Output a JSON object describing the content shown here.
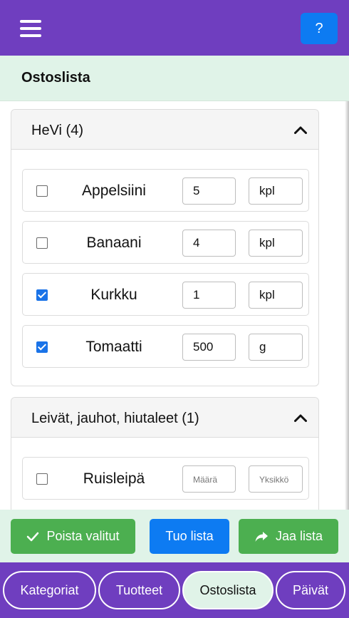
{
  "header": {
    "menu_icon": "hamburger-menu-icon",
    "help_label": "?"
  },
  "page": {
    "title": "Ostoslista"
  },
  "categories": [
    {
      "title": "HeVi (4)",
      "expanded": true,
      "items": [
        {
          "name": "Appelsiini",
          "checked": false,
          "quantity": "5",
          "unit": "kpl"
        },
        {
          "name": "Banaani",
          "checked": false,
          "quantity": "4",
          "unit": "kpl"
        },
        {
          "name": "Kurkku",
          "checked": true,
          "quantity": "1",
          "unit": "kpl"
        },
        {
          "name": "Tomaatti",
          "checked": true,
          "quantity": "500",
          "unit": "g"
        }
      ]
    },
    {
      "title": "Leivät, jauhot, hiutaleet (1)",
      "expanded": true,
      "items": [
        {
          "name": "Ruisleipä",
          "checked": false,
          "quantity": "",
          "unit": "",
          "quantity_placeholder": "Määrä",
          "unit_placeholder": "Yksikkö"
        }
      ]
    }
  ],
  "actions": {
    "delete_selected": "Poista valitut",
    "import_list": "Tuo lista",
    "share_list": "Jaa lista"
  },
  "nav": {
    "tabs": [
      "Kategoriat",
      "Tuotteet",
      "Ostoslista",
      "Päivät"
    ],
    "active": "Ostoslista"
  },
  "colors": {
    "primary_purple": "#6f3ebf",
    "accent_blue": "#0d7bf2",
    "success_green": "#4caf50",
    "mint": "#e0f3e8"
  }
}
